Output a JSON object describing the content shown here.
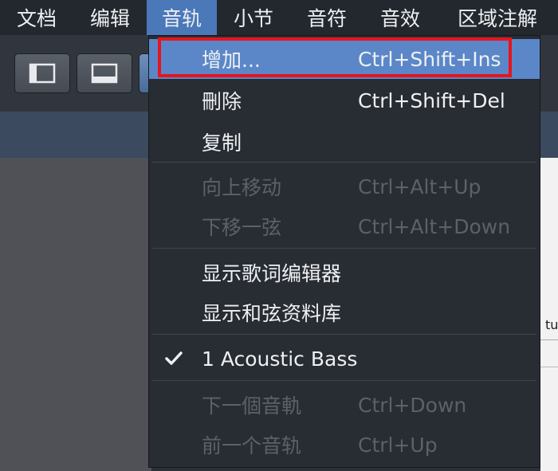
{
  "menubar": {
    "items": [
      "文档",
      "编辑",
      "音轨",
      "小节",
      "音符",
      "音效",
      "区域注解"
    ],
    "active_index": 2
  },
  "track_menu": {
    "items": [
      {
        "label": "增加...",
        "shortcut": "Ctrl+Shift+Ins",
        "enabled": true,
        "highlighted": true
      },
      {
        "label": "刪除",
        "shortcut": "Ctrl+Shift+Del",
        "enabled": true
      },
      {
        "label": "复制",
        "shortcut": "",
        "enabled": true
      },
      {
        "label": "向上移动",
        "shortcut": "Ctrl+Alt+Up",
        "enabled": false
      },
      {
        "label": "下移一弦",
        "shortcut": "Ctrl+Alt+Down",
        "enabled": false
      },
      {
        "label": "显示歌词编辑器",
        "shortcut": "",
        "enabled": true
      },
      {
        "label": "显示和弦资料库",
        "shortcut": "",
        "enabled": true
      },
      {
        "label": "1 Acoustic Bass",
        "shortcut": "",
        "enabled": true,
        "checked": true
      },
      {
        "label": "下一個音軌",
        "shortcut": "Ctrl+Down",
        "enabled": false
      },
      {
        "label": "前一个音轨",
        "shortcut": "Ctrl+Up",
        "enabled": false
      }
    ]
  },
  "side_panel": {
    "partial_text": "tu"
  },
  "colors": {
    "menubar_bg": "#23272e",
    "menu_bg": "#282c33",
    "highlight": "#5b87c9",
    "focus_outline": "#e8141c",
    "disabled_text": "#5c6168"
  }
}
